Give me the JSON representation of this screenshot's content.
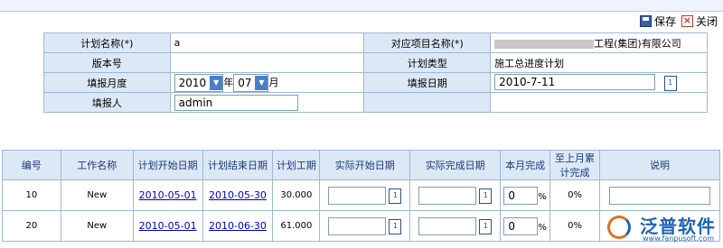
{
  "toolbar": {
    "save": "保存",
    "close": "关闭"
  },
  "form": {
    "plan_name_label": "计划名称(*)",
    "plan_name_value": "a",
    "project_label": "对应项目名称(*)",
    "project_value": "工程(集团)有限公司",
    "version_label": "版本号",
    "plan_type_label": "计划类型",
    "plan_type_value": "施工总进度计划",
    "month_label": "填报月度",
    "year": "2010",
    "year_suffix": "年",
    "month": "07",
    "month_suffix": "月",
    "date_label": "填报日期",
    "date_value": "2010-7-11",
    "reporter_label": "填报人",
    "reporter_value": "admin"
  },
  "grid": {
    "headers": [
      "编号",
      "工作名称",
      "计划开始日期",
      "计划结束日期",
      "计划工期",
      "实际开始日期",
      "实际完成日期",
      "本月完成",
      "至上月累计完成",
      "说明"
    ],
    "rows": [
      {
        "id": "10",
        "name": "New",
        "start": "2010-05-01",
        "end": "2010-05-30",
        "duration": "30.000",
        "month_done": "0",
        "pct": "%",
        "cum": "0%"
      },
      {
        "id": "20",
        "name": "New",
        "start": "2010-05-01",
        "end": "2010-06-30",
        "duration": "61.000",
        "month_done": "0",
        "pct": "%",
        "cum": "0%"
      }
    ]
  },
  "logo": {
    "name": "泛普软件",
    "url": "www.fanpusoft.com"
  },
  "colors": {
    "header_bg": "#dce8f6",
    "border": "#9db8dc",
    "link": "#0000cc",
    "brand": "#1d64b8"
  }
}
